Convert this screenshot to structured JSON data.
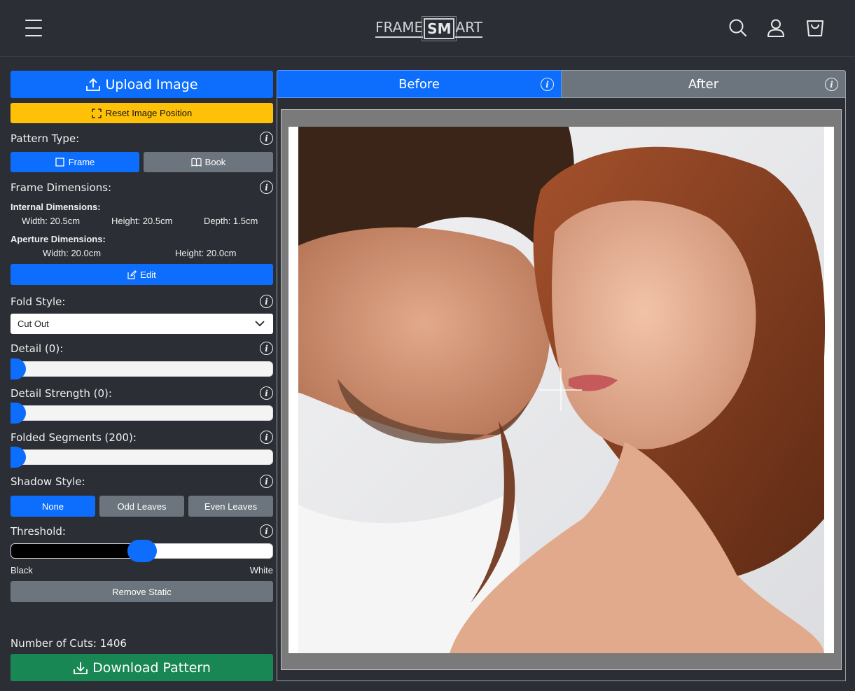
{
  "header": {
    "logo_left": "FRAME",
    "logo_box": "SM",
    "logo_right": "ART"
  },
  "icons": [
    "menu-icon",
    "search-icon",
    "user-icon",
    "cart-icon",
    "upload-icon",
    "expand-icon",
    "square-icon",
    "book-icon",
    "edit-icon",
    "chevron-down-icon",
    "download-icon",
    "info-icon"
  ],
  "sidebar": {
    "upload_label": "Upload Image",
    "reset_label": "Reset Image Position",
    "pattern_type_label": "Pattern Type:",
    "pattern_frame": "Frame",
    "pattern_book": "Book",
    "frame_dimensions_label": "Frame Dimensions:",
    "internal_title": "Internal Dimensions:",
    "internal_width": "Width: 20.5cm",
    "internal_height": "Height: 20.5cm",
    "internal_depth": "Depth: 1.5cm",
    "aperture_title": "Aperture Dimensions:",
    "aperture_width": "Width: 20.0cm",
    "aperture_height": "Height: 20.0cm",
    "edit_label": "Edit",
    "fold_style_label": "Fold Style:",
    "fold_style_value": "Cut Out",
    "detail_label": "Detail (0):",
    "detail_value": 0,
    "detail_strength_label": "Detail Strength (0):",
    "detail_strength_value": 0,
    "folded_segments_label": "Folded Segments (200):",
    "folded_segments_value": 200,
    "shadow_style_label": "Shadow Style:",
    "shadow_none": "None",
    "shadow_odd": "Odd Leaves",
    "shadow_even": "Even Leaves",
    "threshold_label": "Threshold:",
    "threshold_value_fraction": 0.5,
    "threshold_black": "Black",
    "threshold_white": "White",
    "remove_static_label": "Remove Static",
    "cuts_label": "Number of Cuts: 1406",
    "download_label": "Download Pattern"
  },
  "preview": {
    "tab_before": "Before",
    "tab_after": "After",
    "active_tab": "Before"
  },
  "colors": {
    "primary": "#0d6efd",
    "warning": "#ffc107",
    "secondary": "#6c757d",
    "success": "#198754",
    "background": "#2b2f35"
  }
}
